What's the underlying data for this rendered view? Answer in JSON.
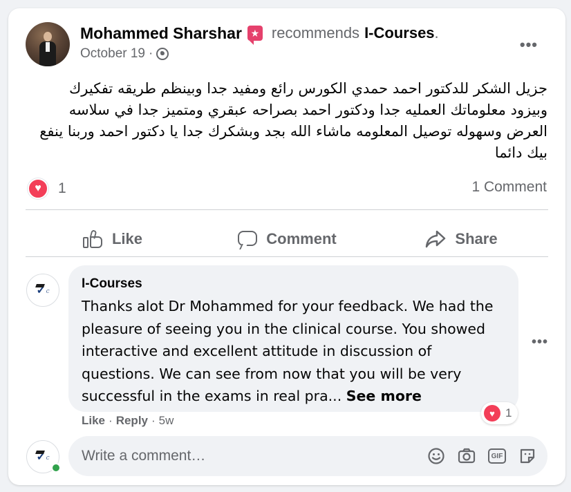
{
  "post": {
    "author": "Mohammed Sharshar",
    "recommends_text": "recommends",
    "page_name": "I-Courses",
    "page_name_suffix": ".",
    "date": "October 19",
    "meta_sep": "·",
    "text": "جزيل الشكر للدكتور احمد حمدي الكورس رائع ومفيد جدا وبينظم طريقه تفكيرك وبيزود معلوماتك العمليه جدا ودكتور احمد بصراحه عبقري ومتميز جدا في سلاسه العرض وسهوله توصيل المعلومه ماشاء الله بجد وبشكرك جدا يا دكتور احمد وربنا ينفع بيك دائما",
    "reaction_count": "1",
    "comment_count": "1 Comment",
    "more_icon": "more-horizontal-icon"
  },
  "actions": {
    "like": "Like",
    "comment": "Comment",
    "share": "Share"
  },
  "comment": {
    "author": "I-Courses",
    "text": "Thanks alot Dr Mohammed for your feedback. We had the pleasure of seeing you in the clinical course. You showed interactive and excellent attitude in discussion of questions. We can see from now that you will be very successful in the exams in real pra...",
    "see_more": "See more",
    "like": "Like",
    "reply": "Reply",
    "sep": "·",
    "age": "5w",
    "reaction_count": "1"
  },
  "composer": {
    "placeholder": "Write a comment…",
    "tools": [
      "emoji-icon",
      "camera-icon",
      "gif-icon",
      "sticker-icon"
    ]
  },
  "colors": {
    "love": "#f33e58",
    "badge": "#e5416c",
    "secondary_text": "#65676b",
    "online": "#31a24c"
  }
}
